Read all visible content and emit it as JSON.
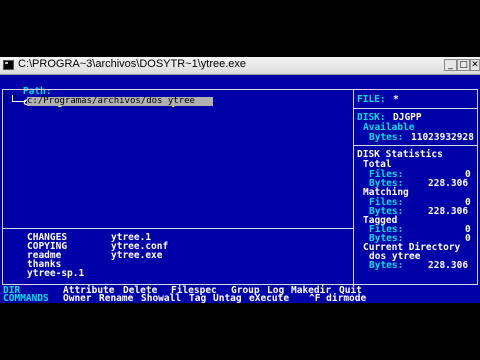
{
  "window": {
    "title": "C:\\PROGRA~3\\archivos\\DOSYTR~1\\ytree.exe",
    "buttons": {
      "minimize": "_",
      "maximize": "□",
      "close": "✕"
    }
  },
  "path": {
    "label": "Path:",
    "value": "c:/Programas/archivos/dos ytree"
  },
  "tree": {
    "selected": "c:/Programas/archivos/dos ytree"
  },
  "file_filter": {
    "label": "FILE:",
    "value": "*"
  },
  "disk": {
    "label": "DISK:",
    "name": "DJGPP",
    "available_label": "Available",
    "bytes_label": "Bytes:",
    "bytes": "11023932928"
  },
  "stats": {
    "title": "DISK Statistics",
    "total": {
      "label": "Total",
      "files_label": "Files:",
      "files": "0",
      "bytes_label": "Bytes:",
      "bytes": "228.306"
    },
    "matching": {
      "label": "Matching",
      "files_label": "Files:",
      "files": "0",
      "bytes_label": "Bytes:",
      "bytes": "228.306"
    },
    "tagged": {
      "label": "Tagged",
      "files_label": "Files:",
      "files": "0",
      "bytes_label": "Bytes:",
      "bytes": "0"
    },
    "current": {
      "label": "Current Directory",
      "name": "dos ytree",
      "bytes_label": "Bytes:",
      "bytes": "228.306"
    }
  },
  "files": {
    "col1": [
      "CHANGES",
      "COPYING",
      "readme",
      "thanks",
      "ytree-sp.1"
    ],
    "col2": [
      "ytree.1",
      "ytree.conf",
      "ytree.exe"
    ]
  },
  "commands": {
    "row1_label": "DIR",
    "row1": [
      "Attribute",
      "Delete",
      "Filespec",
      "Group",
      "Log",
      "Makedir",
      "Quit"
    ],
    "row2_label": "COMMANDS",
    "row2": [
      "Owner",
      "Rename",
      "Showall",
      "Tag",
      "Untag",
      "eXecute",
      "^F dirmode"
    ]
  },
  "colors": {
    "background": "#0000a8",
    "highlight": "#00e0e0",
    "text": "#ffffff",
    "selection": "#b0b0b0"
  }
}
